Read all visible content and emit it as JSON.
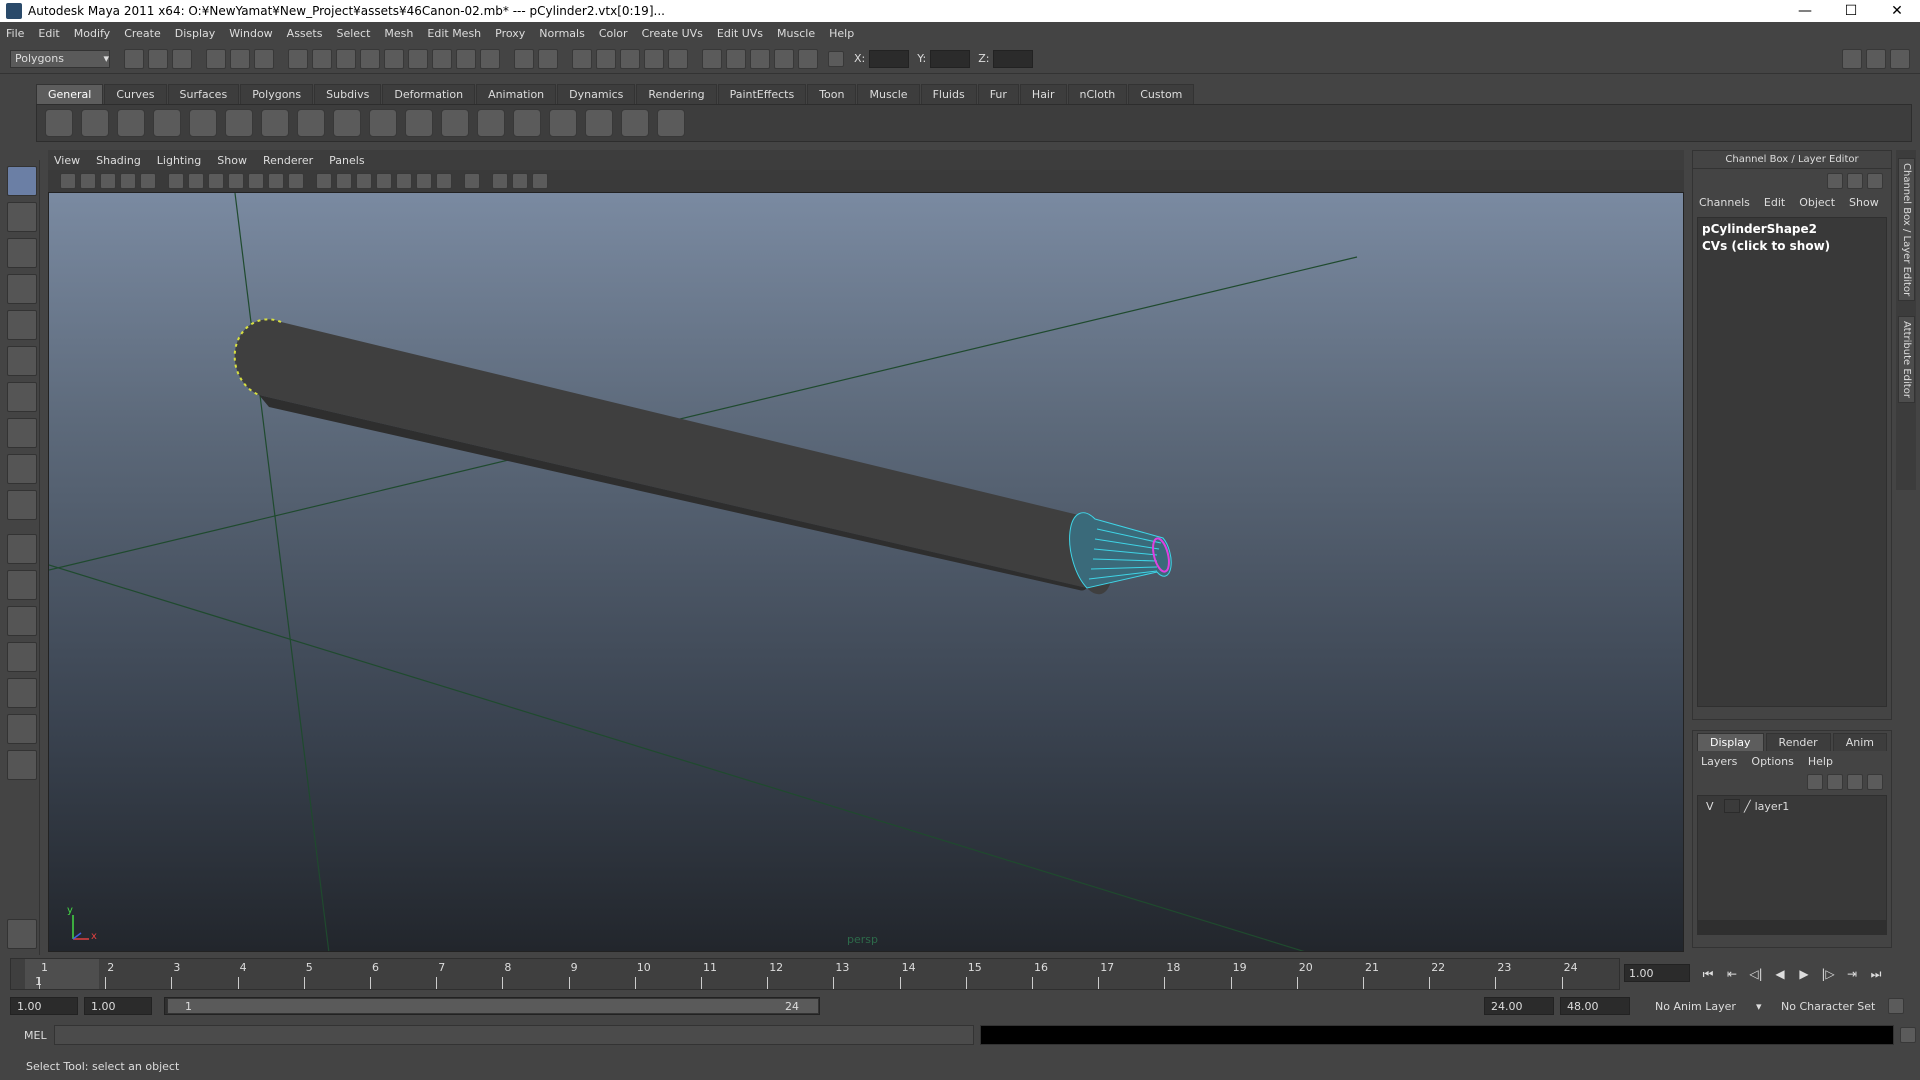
{
  "window": {
    "title": "Autodesk Maya 2011 x64: O:¥NewYamat¥New_Project¥assets¥46Canon-02.mb*  ---  pCylinder2.vtx[0:19]...",
    "minimize": "—",
    "maximize": "☐",
    "close": "✕"
  },
  "menubar": [
    "File",
    "Edit",
    "Modify",
    "Create",
    "Display",
    "Window",
    "Assets",
    "Select",
    "Mesh",
    "Edit Mesh",
    "Proxy",
    "Normals",
    "Color",
    "Create UVs",
    "Edit UVs",
    "Muscle",
    "Help"
  ],
  "statusline": {
    "mode": "Polygons",
    "x_label": "X:",
    "y_label": "Y:",
    "z_label": "Z:"
  },
  "shelf": {
    "tabs": [
      "General",
      "Curves",
      "Surfaces",
      "Polygons",
      "Subdivs",
      "Deformation",
      "Animation",
      "Dynamics",
      "Rendering",
      "PaintEffects",
      "Toon",
      "Muscle",
      "Fluids",
      "Fur",
      "Hair",
      "nCloth",
      "Custom"
    ],
    "active_tab": "General"
  },
  "viewport": {
    "menu": [
      "View",
      "Shading",
      "Lighting",
      "Show",
      "Renderer",
      "Panels"
    ],
    "camera_label": "persp",
    "axis_y": "y",
    "axis_x": "x"
  },
  "channelbox": {
    "title": "Channel Box / Layer Editor",
    "menu": [
      "Channels",
      "Edit",
      "Object",
      "Show"
    ],
    "object": "pCylinderShape2",
    "cvs": "CVs (click to show)",
    "side_tab_1": "Channel Box / Layer Editor",
    "side_tab_2": "Attribute Editor"
  },
  "layers": {
    "tabs": [
      "Display",
      "Render",
      "Anim"
    ],
    "active_tab": "Display",
    "menu": [
      "Layers",
      "Options",
      "Help"
    ],
    "rows": [
      {
        "visible": "V",
        "name": "layer1"
      }
    ]
  },
  "timeline": {
    "ticks": [
      "1",
      "2",
      "3",
      "4",
      "5",
      "6",
      "7",
      "8",
      "9",
      "10",
      "11",
      "12",
      "13",
      "14",
      "15",
      "16",
      "17",
      "18",
      "19",
      "20",
      "21",
      "22",
      "23",
      "24"
    ],
    "current_marker": "1",
    "current_frame": "1.00"
  },
  "range": {
    "start": "1.00",
    "playback_start": "1.00",
    "slider_low": "1",
    "slider_high": "24",
    "playback_end": "24.00",
    "end": "48.00",
    "anim_layer": "No Anim Layer",
    "character_set": "No Character Set"
  },
  "cmdline": {
    "label": "MEL"
  },
  "helpline": {
    "text": "Select Tool: select an object"
  }
}
